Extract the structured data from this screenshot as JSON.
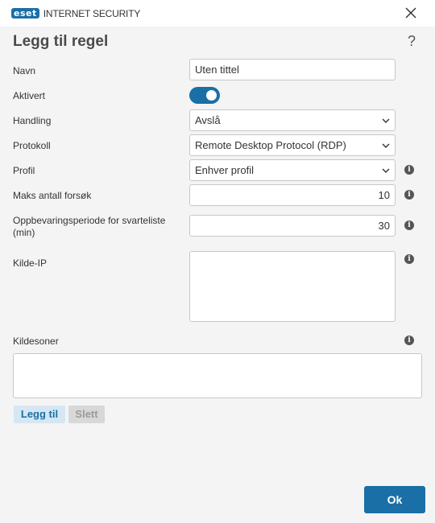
{
  "window": {
    "logo_badge": "eset",
    "product_name": "INTERNET SECURITY",
    "close_icon": "close-icon"
  },
  "dialog": {
    "title": "Legg til regel",
    "help_symbol": "?",
    "info_symbol": "i"
  },
  "fields": {
    "navn": {
      "label": "Navn",
      "value": "Uten tittel"
    },
    "aktivert": {
      "label": "Aktivert",
      "checked": true
    },
    "handling": {
      "label": "Handling",
      "value": "Avslå"
    },
    "protokoll": {
      "label": "Protokoll",
      "value": "Remote Desktop Protocol (RDP)"
    },
    "profil": {
      "label": "Profil",
      "value": "Enhver profil"
    },
    "maks": {
      "label": "Maks antall forsøk",
      "value": "10"
    },
    "oppbevaring": {
      "label": "Oppbevaringsperiode for svarteliste (min)",
      "value": "30"
    },
    "kilde_ip": {
      "label": "Kilde-IP",
      "value": ""
    },
    "kildesoner": {
      "label": "Kildesoner"
    }
  },
  "buttons": {
    "add": "Legg til",
    "delete": "Slett",
    "ok": "Ok"
  },
  "colors": {
    "accent": "#1a6fa6",
    "background": "#f4f4f4"
  }
}
